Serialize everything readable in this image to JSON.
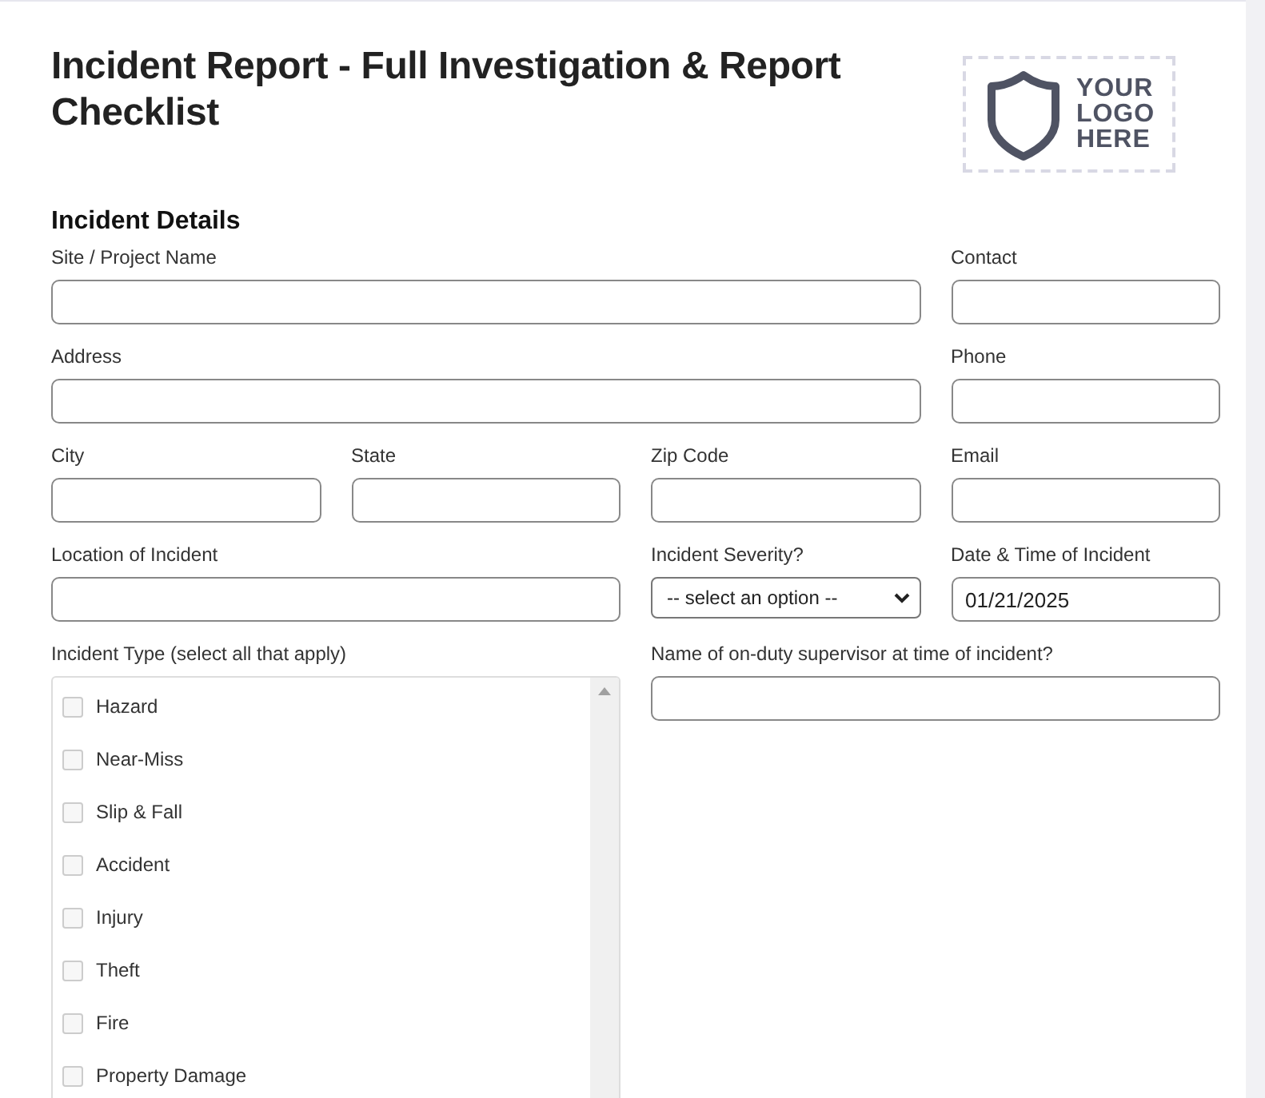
{
  "title": "Incident Report - Full Investigation & Report Checklist",
  "logo": {
    "text": "YOUR LOGO HERE"
  },
  "section": "Incident Details",
  "fields": [
    {
      "kind": "text",
      "label": "Site / Project Name"
    },
    {
      "kind": "text",
      "label": "Contact"
    },
    {
      "kind": "text",
      "label": "Address"
    },
    {
      "kind": "text",
      "label": "Phone"
    },
    {
      "kind": "text",
      "label": "City"
    },
    {
      "kind": "text",
      "label": "State"
    },
    {
      "kind": "text",
      "label": "Zip Code"
    },
    {
      "kind": "text",
      "label": "Email"
    },
    {
      "kind": "text",
      "label": "Location of Incident"
    },
    {
      "kind": "select",
      "label": "Incident Severity?",
      "value": "-- select an option --"
    },
    {
      "kind": "text",
      "label": "Date & Time of Incident",
      "value": "01/21/2025"
    }
  ],
  "incident_type": {
    "label": "Incident Type (select all that apply)",
    "options": [
      {
        "label": "Hazard",
        "checked": false
      },
      {
        "label": "Near-Miss",
        "checked": false
      },
      {
        "label": "Slip & Fall",
        "checked": false
      },
      {
        "label": "Accident",
        "checked": false
      },
      {
        "label": "Injury",
        "checked": false
      },
      {
        "label": "Theft",
        "checked": false
      },
      {
        "label": "Fire",
        "checked": false
      },
      {
        "label": "Property Damage",
        "checked": false
      }
    ]
  },
  "supervisor": {
    "label": "Name of on-duty supervisor at time of incident?"
  }
}
